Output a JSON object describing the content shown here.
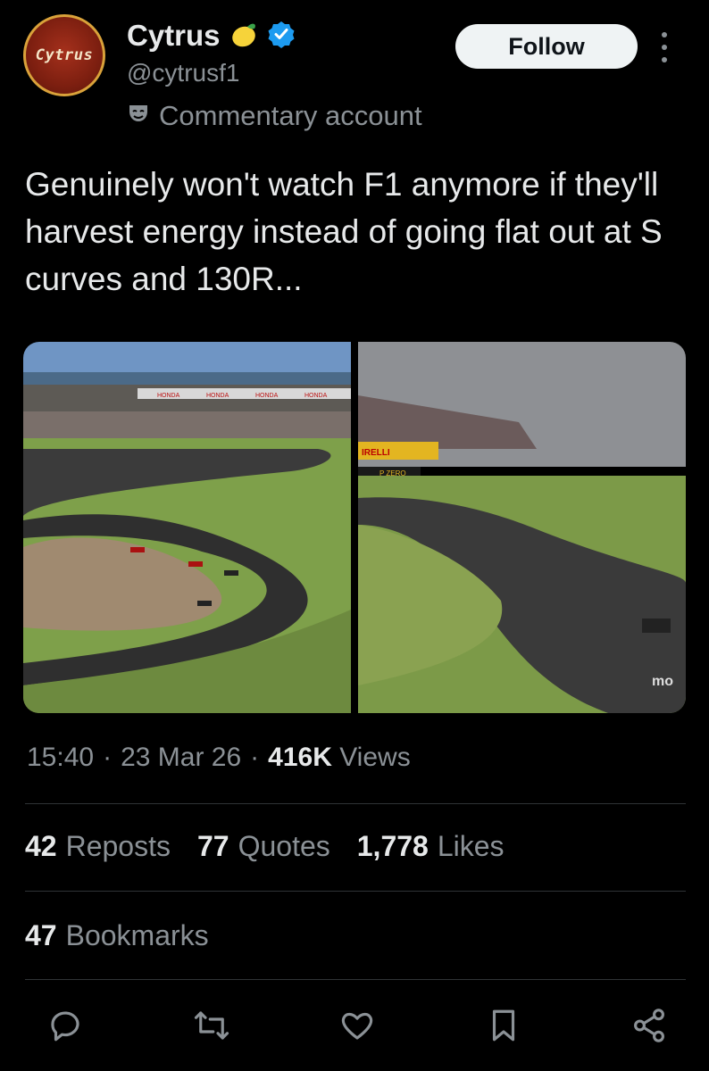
{
  "profile": {
    "avatar_text": "Cytrus",
    "name": "Cytrus",
    "name_emoji": "lemon-icon",
    "verified": "verified-badge-icon",
    "handle": "@cytrusf1",
    "account_label": "Commentary account",
    "account_label_icon": "theater-masks-icon"
  },
  "header": {
    "follow_label": "Follow"
  },
  "post": {
    "text": "Genuinely won't watch F1 anymore if they'll harvest energy instead of going flat out at S curves and 130R..."
  },
  "media": {
    "image1_signs": [
      "HONDA",
      "HONDA",
      "HONDA",
      "HONDA"
    ],
    "image2_signs": [
      "IRELLI",
      "P ZERO"
    ],
    "image2_watermark": "mo"
  },
  "meta": {
    "time": "15:40",
    "date": "23 Mar 26",
    "views_count": "416K",
    "views_label": "Views",
    "sep": "·"
  },
  "stats": {
    "reposts_count": "42",
    "reposts_label": "Reposts",
    "quotes_count": "77",
    "quotes_label": "Quotes",
    "likes_count": "1,778",
    "likes_label": "Likes",
    "bookmarks_count": "47",
    "bookmarks_label": "Bookmarks"
  },
  "colors": {
    "accent": "#1d9bf0",
    "text": "#e7e9ea",
    "muted": "#8b9196",
    "background": "#000000"
  }
}
